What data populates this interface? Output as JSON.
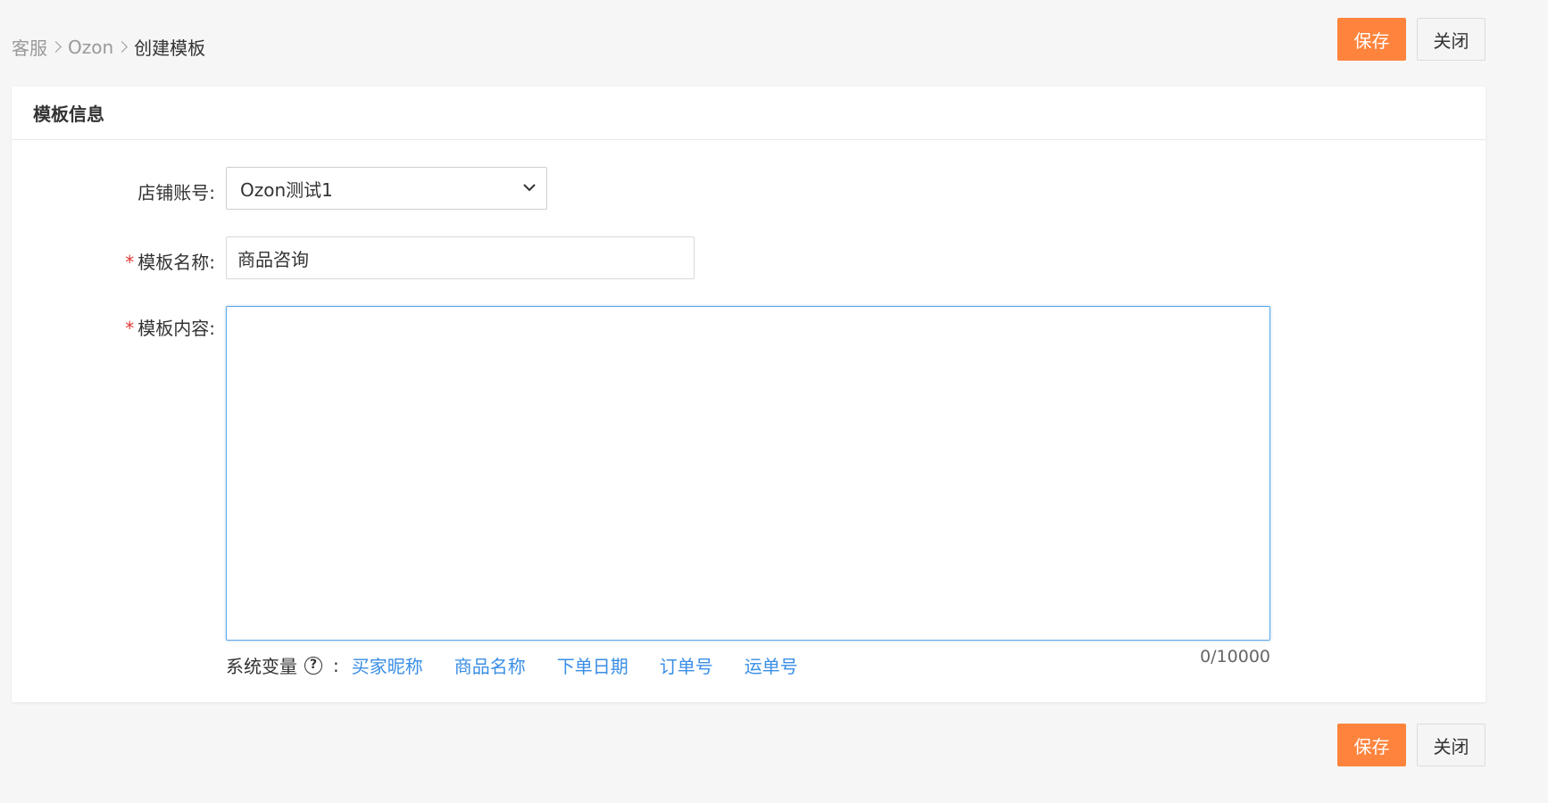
{
  "breadcrumb": {
    "items": [
      "客服",
      "Ozon",
      "创建模板"
    ]
  },
  "actions": {
    "save_label": "保存",
    "close_label": "关闭"
  },
  "card": {
    "title": "模板信息"
  },
  "form": {
    "store_label": "店铺账号:",
    "store_value": "Ozon测试1",
    "name_required": "*",
    "name_label": "模板名称:",
    "name_value": "商品咨询",
    "content_required": "*",
    "content_label": "模板内容:",
    "content_value": "",
    "counter": "0/10000"
  },
  "variables": {
    "label": "系统变量",
    "help_glyph": "?",
    "colon": ":",
    "items": [
      "买家昵称",
      "商品名称",
      "下单日期",
      "订单号",
      "运单号"
    ]
  },
  "colors": {
    "primary": "#fe843d",
    "link": "#3a8ee6",
    "required": "#e53935",
    "focus_border": "#5ea8e6"
  }
}
